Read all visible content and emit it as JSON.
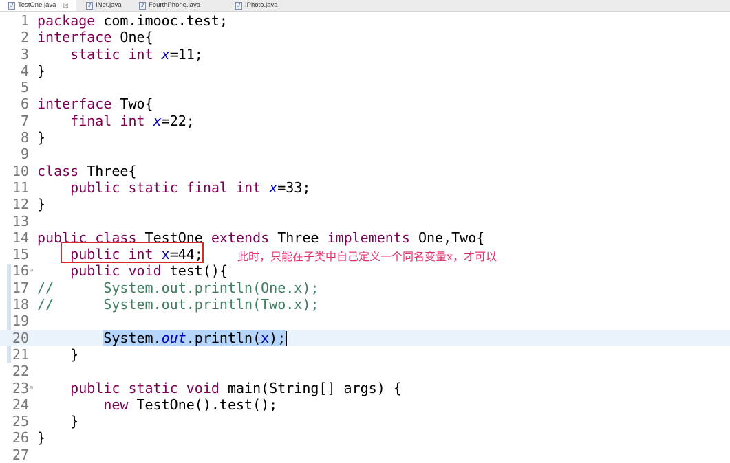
{
  "tabs": [
    {
      "label": "TestOne.java",
      "active": true
    },
    {
      "label": "INet.java"
    },
    {
      "label": "FourthPhone.java"
    },
    {
      "label": "IPhoto.java"
    }
  ],
  "tab_close": "☒",
  "annotation": "此时，只能在子类中自己定义一个同名变量x，才可以",
  "lines": [
    {
      "n": "1",
      "tokens": [
        {
          "t": "package",
          "c": "k"
        },
        {
          "t": " com.imooc.test;",
          "c": "p"
        }
      ]
    },
    {
      "n": "2",
      "tokens": [
        {
          "t": "interface",
          "c": "k"
        },
        {
          "t": " One{",
          "c": "p"
        }
      ]
    },
    {
      "n": "3",
      "tokens": [
        {
          "t": "    ",
          "c": "p"
        },
        {
          "t": "static",
          "c": "k"
        },
        {
          "t": " ",
          "c": "p"
        },
        {
          "t": "int",
          "c": "k"
        },
        {
          "t": " ",
          "c": "p"
        },
        {
          "t": "x",
          "c": "fi"
        },
        {
          "t": "=11;",
          "c": "p"
        }
      ]
    },
    {
      "n": "4",
      "tokens": [
        {
          "t": "}",
          "c": "p"
        }
      ]
    },
    {
      "n": "5",
      "tokens": []
    },
    {
      "n": "6",
      "tokens": [
        {
          "t": "interface",
          "c": "k"
        },
        {
          "t": " Two{",
          "c": "p"
        }
      ]
    },
    {
      "n": "7",
      "tokens": [
        {
          "t": "    ",
          "c": "p"
        },
        {
          "t": "final",
          "c": "k"
        },
        {
          "t": " ",
          "c": "p"
        },
        {
          "t": "int",
          "c": "k"
        },
        {
          "t": " ",
          "c": "p"
        },
        {
          "t": "x",
          "c": "fi"
        },
        {
          "t": "=22;",
          "c": "p"
        }
      ]
    },
    {
      "n": "8",
      "tokens": [
        {
          "t": "}",
          "c": "p"
        }
      ]
    },
    {
      "n": "9",
      "tokens": []
    },
    {
      "n": "10",
      "tokens": [
        {
          "t": "class",
          "c": "k"
        },
        {
          "t": " Three{",
          "c": "p"
        }
      ]
    },
    {
      "n": "11",
      "tokens": [
        {
          "t": "    ",
          "c": "p"
        },
        {
          "t": "public",
          "c": "k"
        },
        {
          "t": " ",
          "c": "p"
        },
        {
          "t": "static",
          "c": "k"
        },
        {
          "t": " ",
          "c": "p"
        },
        {
          "t": "final",
          "c": "k"
        },
        {
          "t": " ",
          "c": "p"
        },
        {
          "t": "int",
          "c": "k"
        },
        {
          "t": " ",
          "c": "p"
        },
        {
          "t": "x",
          "c": "fi"
        },
        {
          "t": "=33;",
          "c": "p"
        }
      ]
    },
    {
      "n": "12",
      "tokens": [
        {
          "t": "}",
          "c": "p"
        }
      ]
    },
    {
      "n": "13",
      "tokens": []
    },
    {
      "n": "14",
      "tokens": [
        {
          "t": "public",
          "c": "k"
        },
        {
          "t": " ",
          "c": "p"
        },
        {
          "t": "class",
          "c": "k"
        },
        {
          "t": " TestOne ",
          "c": "p"
        },
        {
          "t": "extends",
          "c": "k"
        },
        {
          "t": " Three ",
          "c": "p"
        },
        {
          "t": "implements",
          "c": "k"
        },
        {
          "t": " One,Two{",
          "c": "p"
        }
      ]
    },
    {
      "n": "15",
      "tokens": [
        {
          "t": "    ",
          "c": "p"
        },
        {
          "t": "public",
          "c": "k"
        },
        {
          "t": " ",
          "c": "p"
        },
        {
          "t": "int",
          "c": "k"
        },
        {
          "t": " ",
          "c": "p"
        },
        {
          "t": "x",
          "c": "f"
        },
        {
          "t": "=44;",
          "c": "p"
        }
      ]
    },
    {
      "n": "16",
      "fold": true,
      "tokens": [
        {
          "t": "    ",
          "c": "p"
        },
        {
          "t": "public",
          "c": "k"
        },
        {
          "t": " ",
          "c": "p"
        },
        {
          "t": "void",
          "c": "k"
        },
        {
          "t": " test(){",
          "c": "p"
        }
      ]
    },
    {
      "n": "17",
      "tokens": [
        {
          "t": "//      System.out.println(One.x);",
          "c": "c"
        }
      ]
    },
    {
      "n": "18",
      "tokens": [
        {
          "t": "//      System.out.println(Two.x);",
          "c": "c"
        }
      ]
    },
    {
      "n": "19",
      "tokens": []
    },
    {
      "n": "20",
      "current": true,
      "tokens": [
        {
          "t": "        ",
          "c": "p"
        },
        {
          "t": "System.",
          "c": "p sel"
        },
        {
          "t": "out",
          "c": "fi sel"
        },
        {
          "t": ".println(",
          "c": "p sel"
        },
        {
          "t": "x",
          "c": "f sel"
        },
        {
          "t": ");",
          "c": "p sel"
        }
      ]
    },
    {
      "n": "21",
      "tokens": [
        {
          "t": "    }",
          "c": "p"
        }
      ]
    },
    {
      "n": "22",
      "tokens": []
    },
    {
      "n": "23",
      "fold": true,
      "tokens": [
        {
          "t": "    ",
          "c": "p"
        },
        {
          "t": "public",
          "c": "k"
        },
        {
          "t": " ",
          "c": "p"
        },
        {
          "t": "static",
          "c": "k"
        },
        {
          "t": " ",
          "c": "p"
        },
        {
          "t": "void",
          "c": "k"
        },
        {
          "t": " main(String[] args) {",
          "c": "p"
        }
      ]
    },
    {
      "n": "24",
      "tokens": [
        {
          "t": "        ",
          "c": "p"
        },
        {
          "t": "new",
          "c": "k"
        },
        {
          "t": " TestOne().test();",
          "c": "p"
        }
      ]
    },
    {
      "n": "25",
      "tokens": [
        {
          "t": "    }",
          "c": "p"
        }
      ]
    },
    {
      "n": "26",
      "tokens": [
        {
          "t": "}",
          "c": "p"
        }
      ]
    },
    {
      "n": "27",
      "tokens": []
    }
  ]
}
